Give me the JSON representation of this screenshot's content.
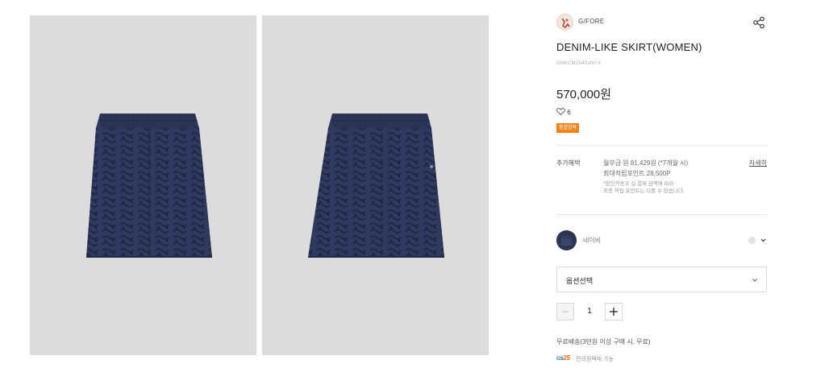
{
  "gallery": {
    "images": [
      {
        "alt": "navy denim-like mini skirt front view"
      },
      {
        "alt": "navy denim-like mini skirt alternate view"
      }
    ]
  },
  "product": {
    "brand": "G/FORE",
    "title": "DENIM-LIKE SKIRT(WOMEN)",
    "code": "GNKCM25401NYX",
    "price": "570,000원",
    "likes": "6",
    "badge": "품절임박"
  },
  "benefits": {
    "label": "추가혜택",
    "installment": "월부금 원 81,429원 (*7개월 시)",
    "points": "최대적립포인트 28,500P",
    "note1": "*할인적용과 실 결제 금액에 따라",
    "note2": "최종 적립 포인트는 다를 수 있습니다.",
    "detail_link": "자세히"
  },
  "color": {
    "name": "네이비",
    "swatch_hex": "#2c3552"
  },
  "option_select": {
    "label": "옵션선택"
  },
  "quantity": {
    "value": "1"
  },
  "shipping": {
    "text": "무료배송(3만원 이상 구매 시, 무료)"
  },
  "pickup": {
    "logo_gs": "GS",
    "logo_25": "25",
    "text": "편의점택배 가능"
  },
  "colors": {
    "badge": "#f0851f",
    "navy": "#2c3552",
    "photo_bg": "#dcdcdc"
  },
  "icons": {
    "share": "share-icon",
    "heart": "heart-icon",
    "chevron": "chevron-down-icon",
    "minus": "minus-icon",
    "plus": "plus-icon"
  }
}
